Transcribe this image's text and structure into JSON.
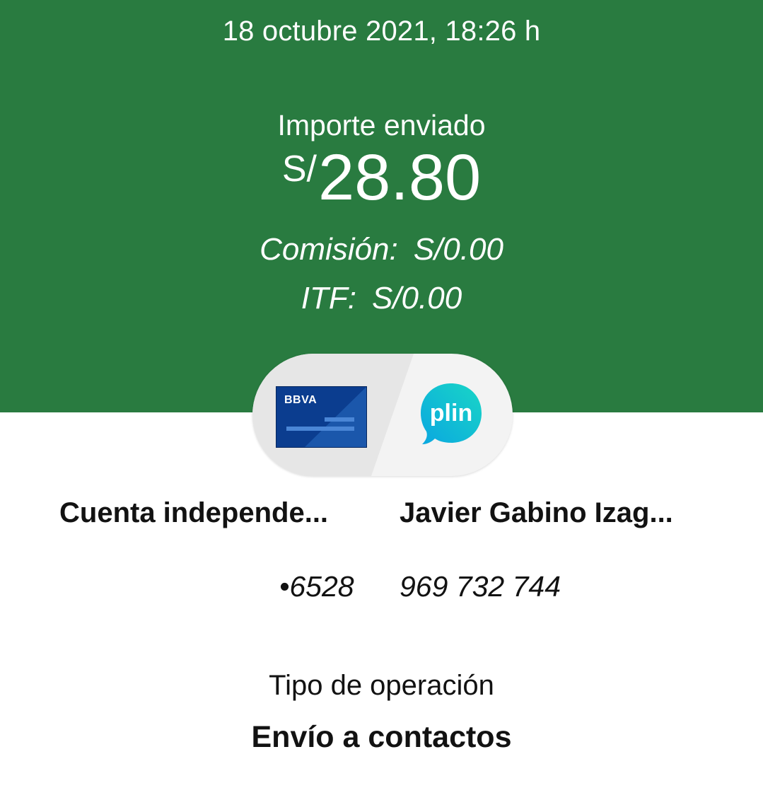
{
  "header": {
    "datetime": "18 octubre 2021, 18:26 h",
    "amount_label": "Importe enviado",
    "currency_symbol": "S/",
    "amount": "28.80",
    "fee_label": "Comisión:",
    "fee_value": "S/0.00",
    "itf_label": "ITF:",
    "itf_value": "S/0.00",
    "background_color": "#297b40"
  },
  "transfer": {
    "source_logo": "BBVA",
    "dest_logo": "plin",
    "source_icon": "bbva-card-icon",
    "dest_icon": "plin-logo-icon"
  },
  "source": {
    "name": "Cuenta independe...",
    "number": "•6528"
  },
  "destination": {
    "name": "Javier Gabino Izag...",
    "number": "969 732 744"
  },
  "operation": {
    "label": "Tipo de operación",
    "value": "Envío a contactos"
  }
}
